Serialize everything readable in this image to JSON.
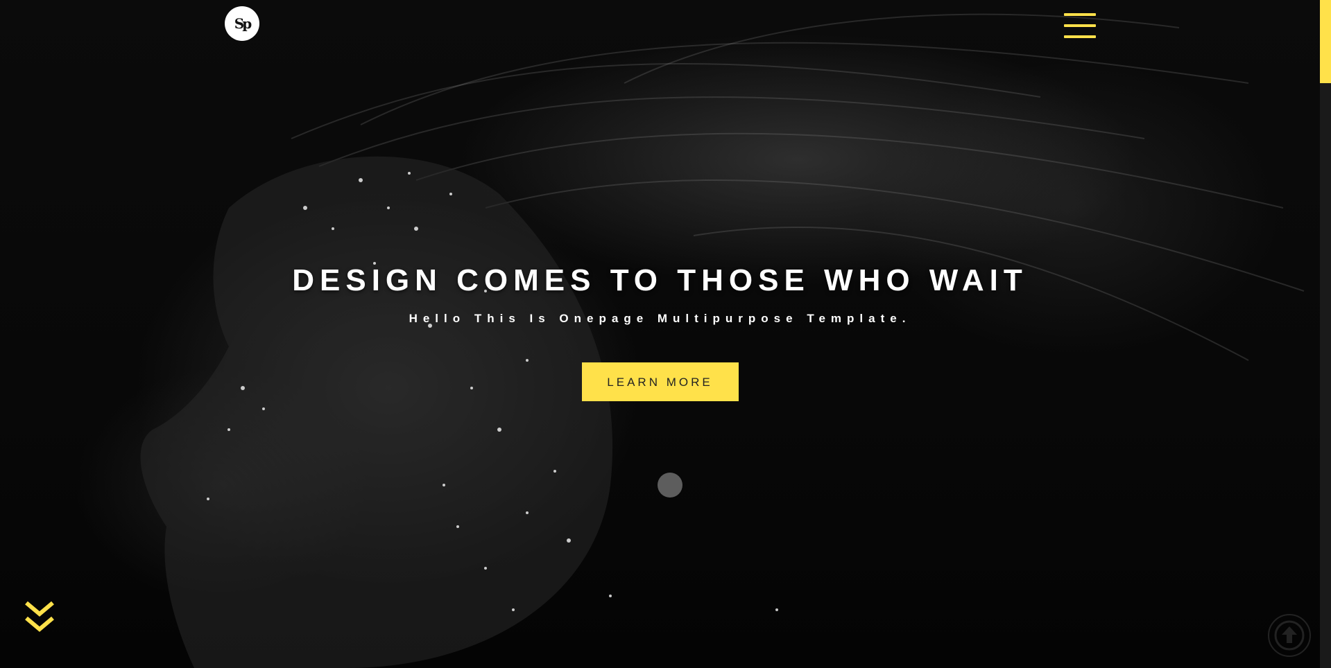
{
  "brand": {
    "logo_text": "Sp",
    "accent_color": "#ffe14a"
  },
  "nav": {
    "menu_icon": "hamburger-menu-icon"
  },
  "hero": {
    "title": "DESIGN COMES TO THOSE WHO WAIT",
    "subtitle": "Hello This Is Onepage Multipurpose Template.",
    "cta_label": "LEARN MORE"
  },
  "controls": {
    "scroll_down_icon": "double-chevron-down-icon",
    "back_to_top_icon": "arrow-up-circle-icon"
  }
}
